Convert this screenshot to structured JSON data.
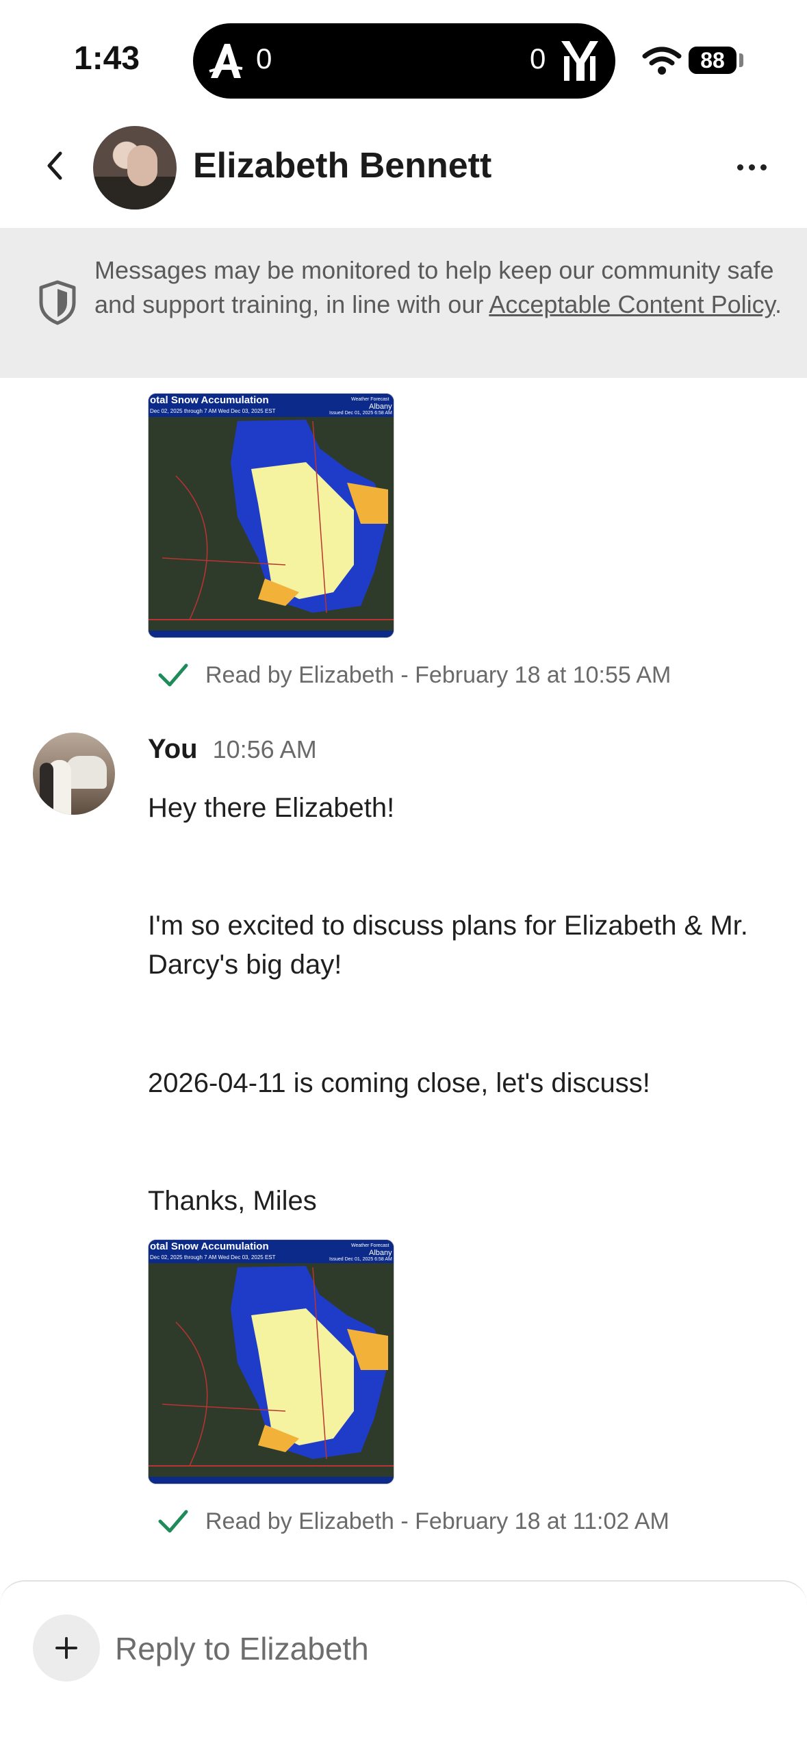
{
  "status_bar": {
    "time": "1:43",
    "left_score": "0",
    "right_score": "0",
    "battery": "88"
  },
  "header": {
    "contact_name": "Elizabeth Bennett",
    "back_icon": "chevron-left-icon",
    "more_icon": "ellipsis-icon"
  },
  "notice": {
    "text_before": "Messages may be monitored to help keep our community safe and support training, in line with our ",
    "link_text": "Acceptable Content Policy",
    "text_after": "."
  },
  "messages": {
    "first_attachment_receipt": "Read by Elizabeth - February 18 at 10:55 AM",
    "sender": "You",
    "time": "10:56 AM",
    "lines": [
      "Hey there Elizabeth!",
      "I'm so excited to discuss plans for Elizabeth & Mr. Darcy's big day!",
      "2026-04-11 is coming close, let's discuss!",
      "Thanks, Miles"
    ],
    "second_attachment_receipt": "Read by Elizabeth - February 18 at 11:02 AM"
  },
  "map_image": {
    "title": "otal Snow Accumulation",
    "subtitle": "Dec 02, 2025 through 7 AM Wed Dec 03, 2025 EST",
    "agency": "Weather Forecast",
    "office": "Albany",
    "issued": "Issued Dec 01, 2025 6:58 AM"
  },
  "composer": {
    "placeholder": "Reply to Elizabeth"
  },
  "colors": {
    "accent_check": "#1f8a5a",
    "notice_bg": "#ececec"
  }
}
